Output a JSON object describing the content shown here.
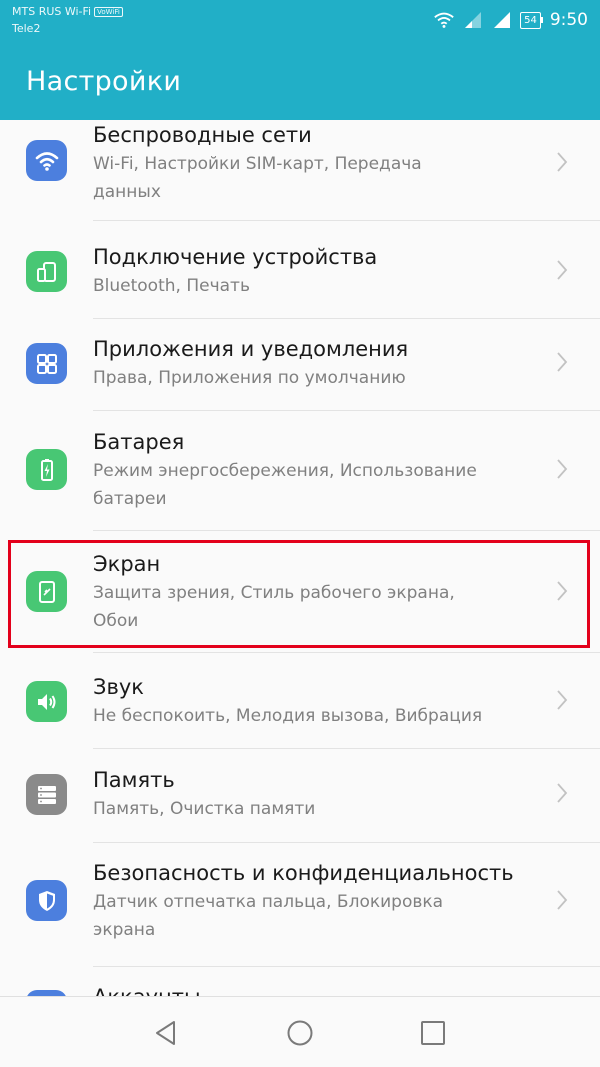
{
  "status_bar": {
    "carrier_primary": "MTS RUS Wi-Fi",
    "wifi_badge": "VoWiFi",
    "carrier_secondary": "Tele2",
    "battery_level": "54",
    "time": "9:50"
  },
  "app_bar": {
    "title": "Настройки"
  },
  "colors": {
    "accent": "#21afc7",
    "icon_blue": "#4c7fde",
    "icon_green": "#48c774",
    "icon_gray": "#8a8a8a",
    "highlight": "#e3001b"
  },
  "settings": [
    {
      "title": "Беспроводные сети",
      "subtitle_line1": "Wi-Fi, Настройки SIM-карт, Передача",
      "subtitle_line2": "данных",
      "icon": "wifi-icon"
    },
    {
      "title": "Подключение устройства",
      "subtitle_line1": "Bluetooth, Печать",
      "subtitle_line2": "",
      "icon": "device-connection-icon"
    },
    {
      "title": "Приложения и уведомления",
      "subtitle_line1": "Права, Приложения по умолчанию",
      "subtitle_line2": "",
      "icon": "apps-icon"
    },
    {
      "title": "Батарея",
      "subtitle_line1": "Режим энергосбережения, Использование",
      "subtitle_line2": "батареи",
      "icon": "battery-icon"
    },
    {
      "title": "Экран",
      "subtitle_line1": "Защита зрения, Стиль рабочего экрана,",
      "subtitle_line2": "Обои",
      "icon": "display-icon"
    },
    {
      "title": "Звук",
      "subtitle_line1": "Не беспокоить, Мелодия вызова, Вибрация",
      "subtitle_line2": "",
      "icon": "speaker-icon"
    },
    {
      "title": "Память",
      "subtitle_line1": "Память, Очистка памяти",
      "subtitle_line2": "",
      "icon": "storage-icon"
    },
    {
      "title": "Безопасность и конфиденциальность",
      "subtitle_line1": "Датчик отпечатка пальца, Блокировка",
      "subtitle_line2": "экрана",
      "icon": "shield-icon"
    },
    {
      "title": "Аккаунты",
      "subtitle_line1": "",
      "subtitle_line2": "",
      "icon": "accounts-icon"
    }
  ],
  "navigation": {
    "back": "back-icon",
    "home": "home-icon",
    "recents": "recents-icon"
  }
}
